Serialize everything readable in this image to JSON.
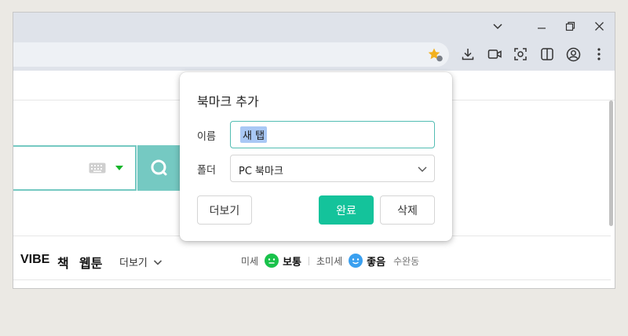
{
  "window_controls": {
    "dropdown_icon": "chevron-down",
    "minimize_icon": "minimize",
    "restore_icon": "restore",
    "close_icon": "close"
  },
  "toolbar": {
    "icons": [
      "bookmark-star-icon",
      "download-icon",
      "cast-icon",
      "screenshot-icon",
      "split-view-icon",
      "profile-icon",
      "menu-icon"
    ],
    "accent": "#f2b01e"
  },
  "page": {
    "search_accent": "#75c9c2",
    "nav": {
      "vibe": "VIBE",
      "book": "책",
      "webtoon": "웹툰",
      "more": "더보기"
    },
    "weather": {
      "fine_dust_label": "미세",
      "fine_dust_status": "보통",
      "fine_dust_color": "#19c24b",
      "ultra_fine_dust_label": "초미세",
      "ultra_fine_dust_status": "좋음",
      "ultra_fine_dust_color": "#3aa0f0",
      "location": "수완동"
    }
  },
  "bookmark_dialog": {
    "title": "북마크 추가",
    "name_label": "이름",
    "name_value": "새 탭",
    "folder_label": "폴더",
    "folder_value": "PC 북마크",
    "more_button": "더보기",
    "done_button": "완료",
    "delete_button": "삭제",
    "done_color": "#14c39b"
  }
}
